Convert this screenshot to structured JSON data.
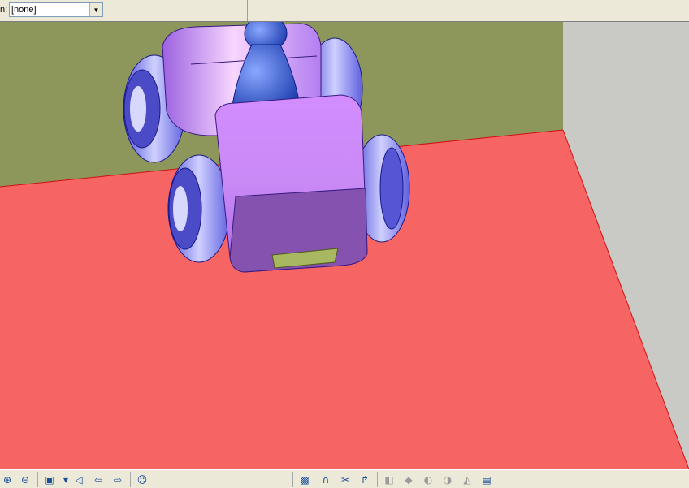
{
  "filter": {
    "label_fragment": "n:",
    "value": "[none]"
  },
  "toolbar_left": [
    {
      "name": "zoom-in-icon",
      "glyph": "⊕"
    },
    {
      "name": "zoom-out-icon",
      "glyph": "⊖"
    },
    {
      "name": "view-cube-icon",
      "glyph": "▣"
    },
    {
      "name": "dropdown-arrow-icon",
      "glyph": "▾"
    },
    {
      "name": "perspective-icon",
      "glyph": "◁"
    },
    {
      "name": "back-arrow-icon",
      "glyph": "⇦"
    },
    {
      "name": "forward-arrow-icon",
      "glyph": "⇨"
    },
    {
      "name": "smiley-icon",
      "glyph": "☺"
    }
  ],
  "toolbar_right": [
    {
      "name": "box-icon",
      "glyph": "▩"
    },
    {
      "name": "arch-icon",
      "glyph": "∩"
    },
    {
      "name": "scissors-icon",
      "glyph": "✂"
    },
    {
      "name": "bend-pipe-icon",
      "glyph": "↱"
    },
    {
      "name": "disabled-tool-1-icon",
      "glyph": "◧"
    },
    {
      "name": "disabled-tool-2-icon",
      "glyph": "◆"
    },
    {
      "name": "disabled-tool-3-icon",
      "glyph": "◐"
    },
    {
      "name": "disabled-tool-4-icon",
      "glyph": "◑"
    },
    {
      "name": "disabled-tool-5-icon",
      "glyph": "◭"
    },
    {
      "name": "stacked-boxes-icon",
      "glyph": "▤"
    }
  ],
  "colors": {
    "floor": "#f76464",
    "back_wall": "#8d975c",
    "side_wall": "#c9c9c6",
    "body": "#b77cf0",
    "wheel": "#6e6ef2",
    "driver": "#2e5fd6",
    "bumper": "#a8b860"
  }
}
